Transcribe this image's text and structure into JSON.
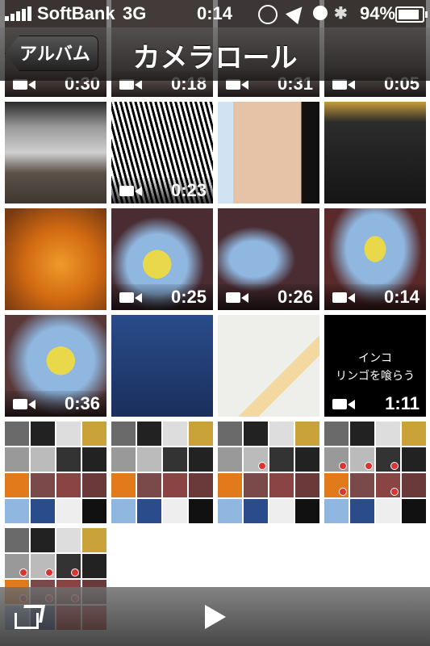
{
  "status_bar": {
    "carrier": "SoftBank",
    "network": "3G",
    "time": "0:14",
    "battery": "94%"
  },
  "nav": {
    "back_label": "アルバム",
    "title": "カメラロール"
  },
  "top_row_durations": [
    "0:30",
    "0:18",
    "0:31",
    "0:05"
  ],
  "grid": {
    "row1_video_duration": "0:23",
    "row2_durations": [
      "0:25",
      "0:26",
      "0:14"
    ],
    "row3_duration_1": "0:36",
    "row3_duration_4": "1:11",
    "video_caption_line1": "インコ",
    "video_caption_line2": "リンゴを喰らう"
  },
  "colors": {
    "bar_dark": "#1e1e1e",
    "accent_orange": "#e07a1a",
    "budgie_blue": "#8fb7e0",
    "budgie_yellow": "#e8d84a"
  }
}
